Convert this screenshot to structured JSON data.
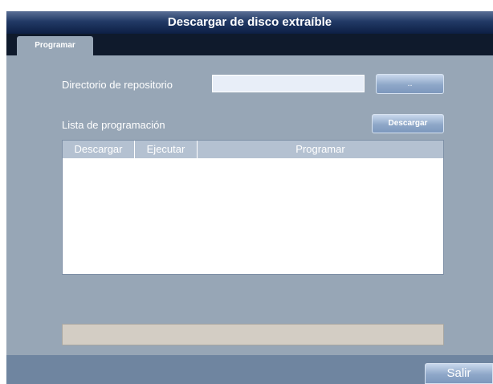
{
  "window": {
    "title": "Descargar de  disco extraíble"
  },
  "tabs": [
    {
      "label": "Programar"
    }
  ],
  "repository": {
    "label": "Directorio de repositorio",
    "value": "",
    "browse_label": ".."
  },
  "schedule": {
    "label": "Lista de programación",
    "download_label": "Descargar",
    "columns": [
      "Descargar",
      "Ejecutar",
      "Programar"
    ],
    "rows": []
  },
  "progress": {
    "value": 0
  },
  "footer": {
    "exit_label": "Salir"
  },
  "colors": {
    "window_bg": "#97a6b6",
    "titlebar": "#0d1f44",
    "tabstrip": "#0f1a2c",
    "statusbar": "#6f85a0",
    "progress_track": "#d3cdc4",
    "button": "#8ea7c8"
  }
}
